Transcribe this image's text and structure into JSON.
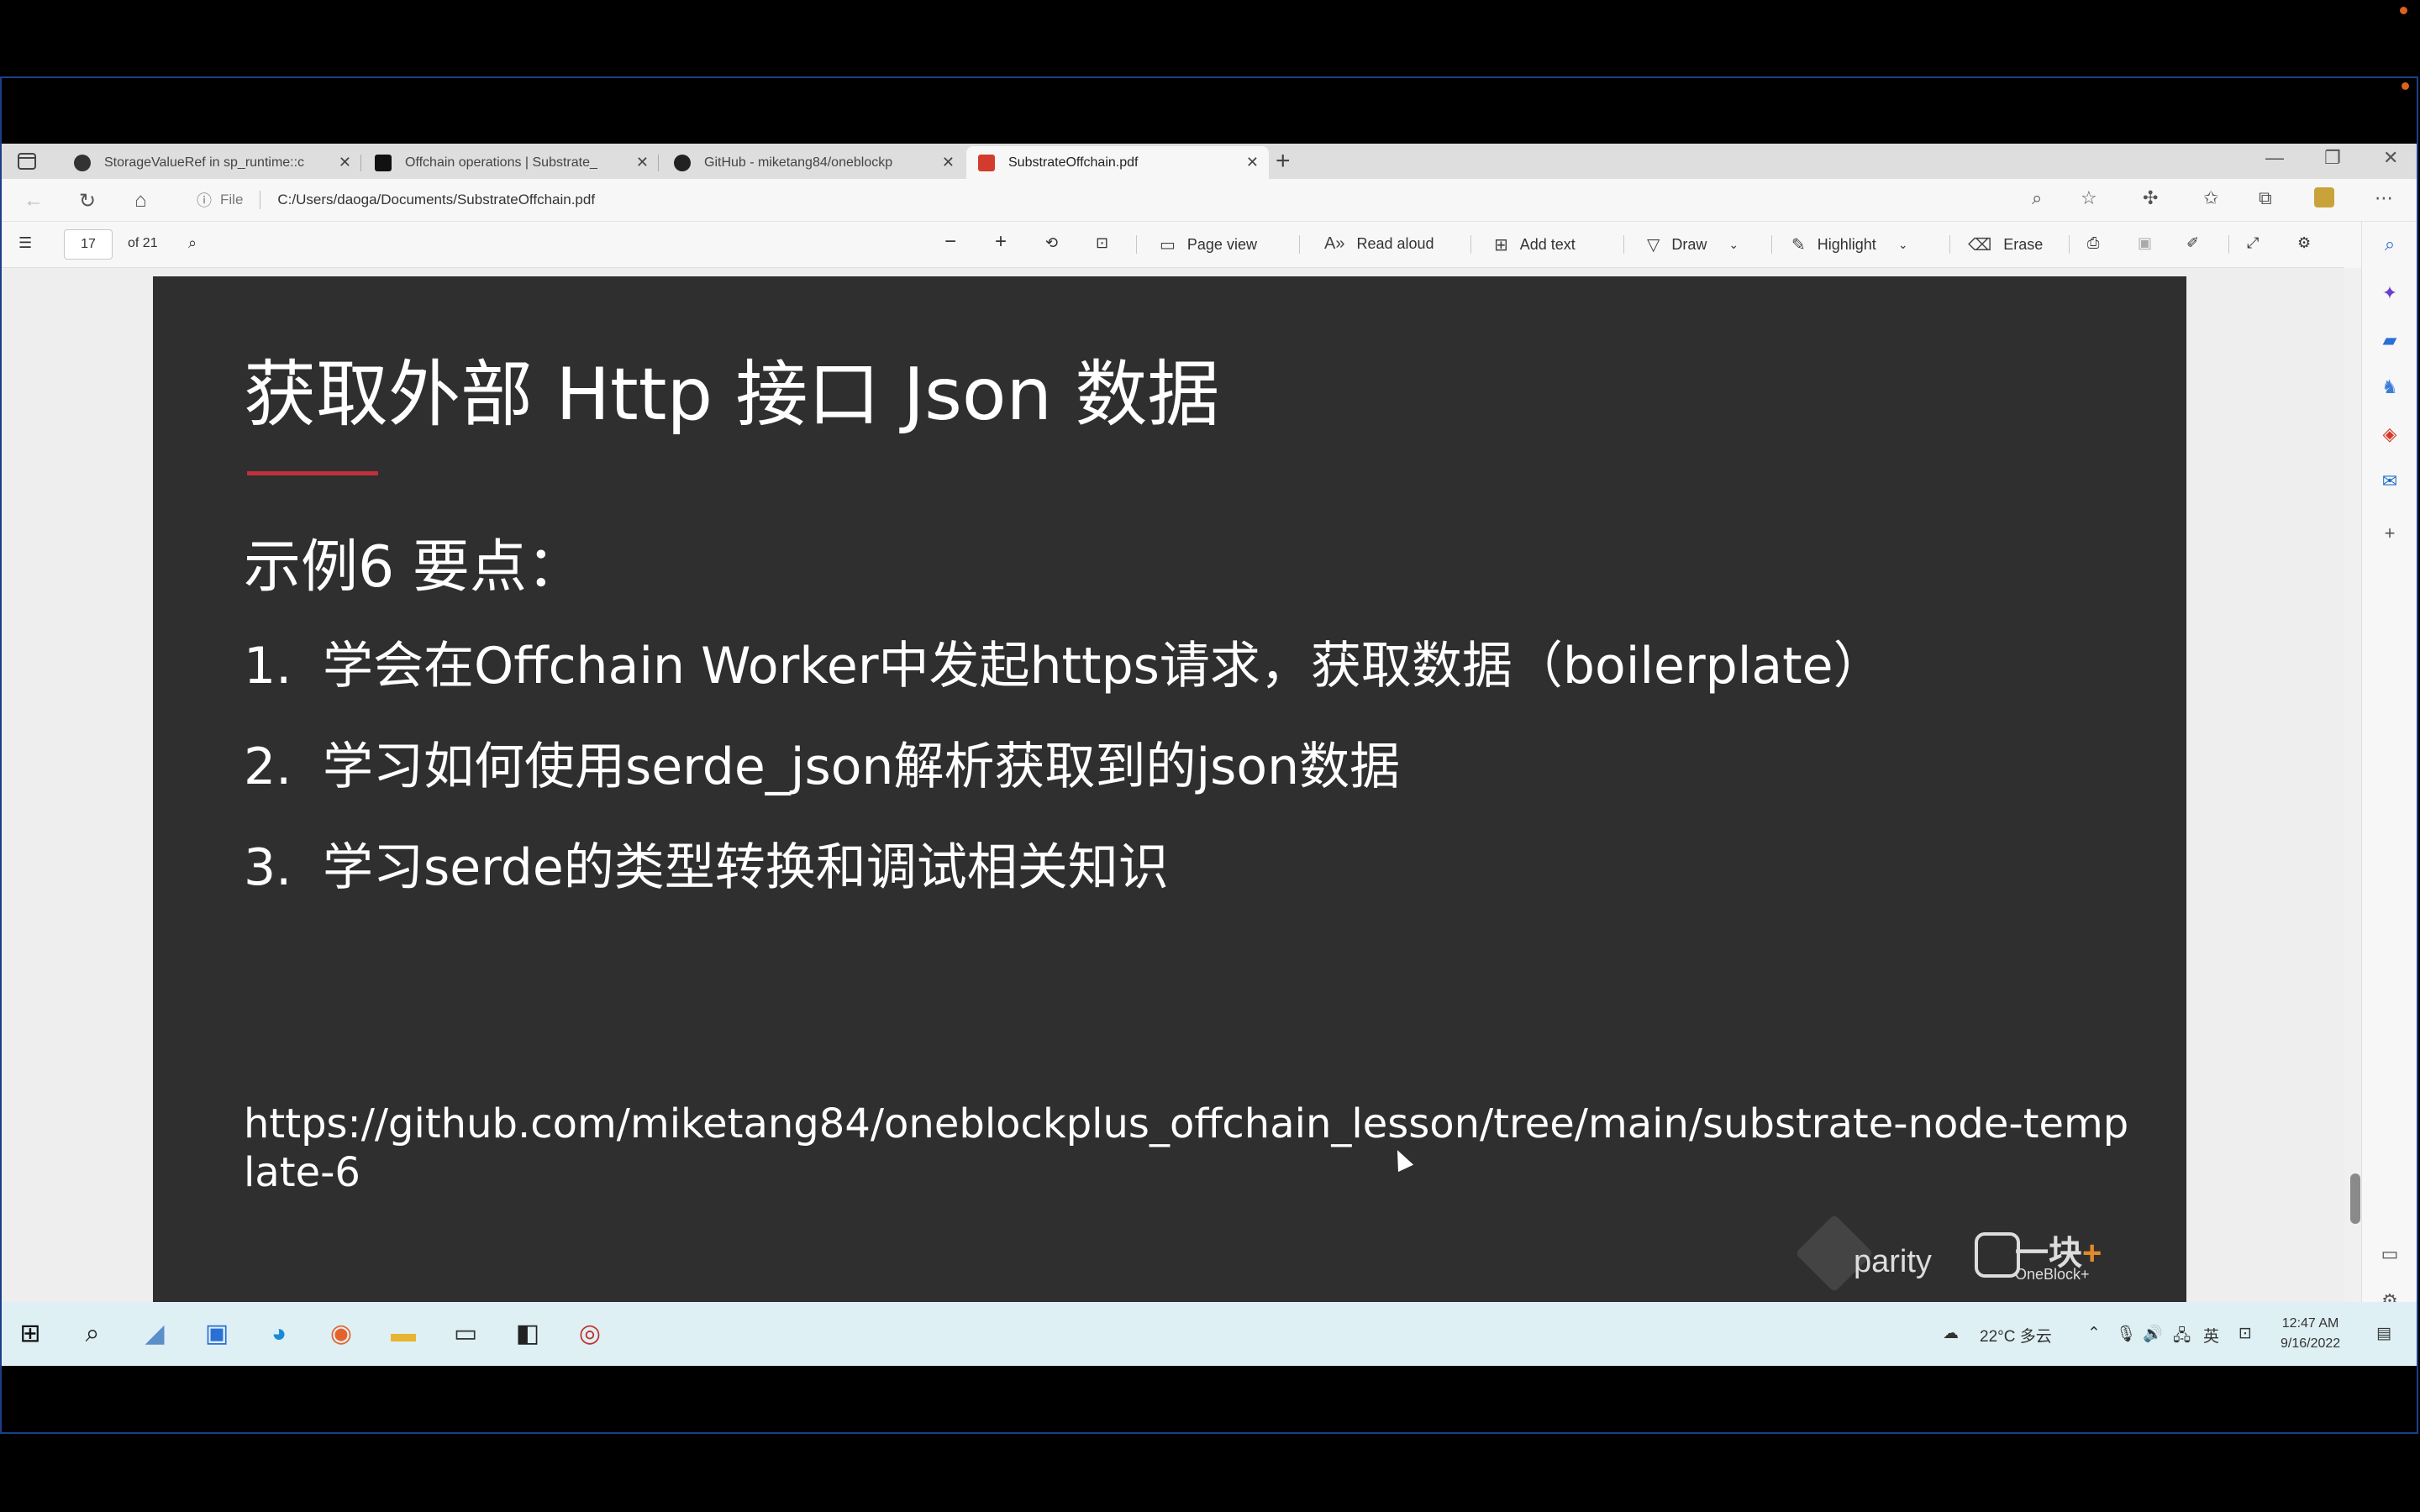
{
  "tabs": [
    {
      "label": "StorageValueRef in sp_runtime::c",
      "icon": "substrate-docs-icon"
    },
    {
      "label": "Offchain operations | Substrate_",
      "icon": "substrate-icon"
    },
    {
      "label": "GitHub - miketang84/oneblockp",
      "icon": "github-icon"
    },
    {
      "label": "SubstrateOffchain.pdf",
      "icon": "pdf-icon"
    }
  ],
  "address": {
    "scheme_label": "File",
    "url": "C:/Users/daoga/Documents/SubstrateOffchain.pdf"
  },
  "pdf_toolbar": {
    "page_current": "17",
    "page_total": "of 21",
    "page_view": "Page view",
    "read_aloud": "Read aloud",
    "add_text": "Add text",
    "draw": "Draw",
    "highlight": "Highlight",
    "erase": "Erase"
  },
  "slide": {
    "title": "获取外部 Http 接口 Json 数据",
    "subtitle": "示例6 要点：",
    "points": [
      {
        "num": "1.",
        "text": "学会在Offchain Worker中发起https请求，获取数据（boilerplate）"
      },
      {
        "num": "2.",
        "text": "学习如何使用serde_json解析获取到的json数据"
      },
      {
        "num": "3.",
        "text": "学习serde的类型转换和调试相关知识"
      }
    ],
    "url": "https://github.com/miketang84/oneblockplus_offchain_lesson/tree/main/substrate-node-template-6",
    "logo_parity": "parity",
    "logo_oneblock": "一块",
    "logo_oneblock_plus": "+",
    "logo_oneblock_sub": "OneBlock+"
  },
  "taskbar": {
    "weather": "22°C 多云",
    "ime": "英",
    "time": "12:47 AM",
    "date": "9/16/2022"
  }
}
